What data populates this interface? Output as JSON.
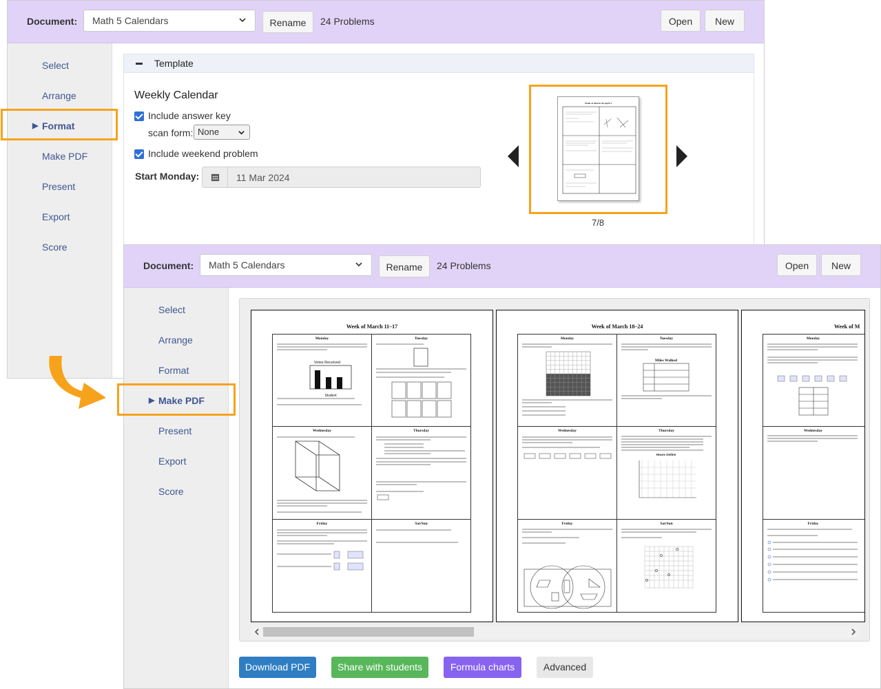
{
  "colors": {
    "accent": "#f7a21b",
    "header_bg": "#e1d3f8",
    "nav_text": "#3f5690",
    "download": "#2f7ec3",
    "share": "#57b75a",
    "formula": "#8763f0",
    "advanced": "#e8e8e8"
  },
  "top": {
    "header": {
      "document_label": "Document:",
      "document_value": "Math 5 Calendars",
      "rename": "Rename",
      "problems": "24 Problems",
      "open": "Open",
      "new": "New"
    },
    "nav": [
      "Select",
      "Arrange",
      "Format",
      "Make PDF",
      "Present",
      "Export",
      "Score"
    ],
    "active_nav": "Format",
    "panel": {
      "title": "Template",
      "template_name": "Weekly Calendar",
      "answer_key_label": "Include answer key",
      "answer_key_checked": true,
      "scan_form_label": "scan form:",
      "scan_form_value": "None",
      "weekend_label": "Include weekend problem",
      "weekend_checked": true,
      "start_label": "Start Monday:",
      "start_value": "11 Mar 2024",
      "preview_title": "Week of March 28-April 3",
      "counter": "7/8"
    }
  },
  "bottom": {
    "header": {
      "document_label": "Document:",
      "document_value": "Math 5 Calendars",
      "rename": "Rename",
      "problems": "24 Problems",
      "open": "Open",
      "new": "New"
    },
    "nav": [
      "Select",
      "Arrange",
      "Format",
      "Make PDF",
      "Present",
      "Export",
      "Score"
    ],
    "active_nav": "Make PDF",
    "pages": [
      {
        "title": "Week of March 11–17",
        "days": [
          "Monday",
          "Tuesday",
          "Wednesday",
          "Thursday",
          "Friday",
          "Sat/Sun"
        ],
        "chart_title": "Votes Received",
        "chart_xlabel": "Student"
      },
      {
        "title": "Week of March 18–24",
        "days": [
          "Monday",
          "Tuesday",
          "Wednesday",
          "Thursday",
          "Friday",
          "Sat/Sun"
        ],
        "table_title": "Miles Walked",
        "graph_title": "Hours Online"
      },
      {
        "title": "Week of M",
        "days": [
          "Monday",
          "",
          "Wednesday",
          "",
          "Friday",
          ""
        ]
      }
    ],
    "buttons": {
      "download": "Download PDF",
      "share": "Share with students",
      "formula": "Formula charts",
      "advanced": "Advanced"
    }
  }
}
